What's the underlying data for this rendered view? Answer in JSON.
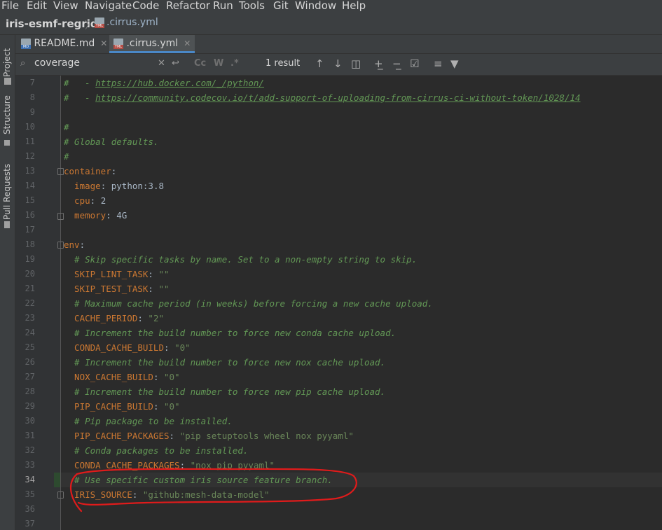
{
  "menu": [
    "File",
    "Edit",
    "View",
    "Navigate",
    "Code",
    "Refactor",
    "Run",
    "Tools",
    "Git",
    "Window",
    "Help"
  ],
  "breadcrumb": {
    "project": "iris-esmf-regrid",
    "file": ".cirrus.yml"
  },
  "side_tabs": {
    "project": "Project",
    "structure": "Structure",
    "pull_requests": "Pull Requests"
  },
  "tabs": [
    {
      "label": "README.md",
      "active": false
    },
    {
      "label": ".cirrus.yml",
      "active": true
    }
  ],
  "search": {
    "query": "coverage",
    "match_case": "Cc",
    "words": "W",
    "regex": ".*",
    "result": "1 result"
  },
  "lines": [
    {
      "n": "7",
      "parts": [
        [
          "c-com",
          "#   - "
        ],
        [
          "c-link",
          "https://hub.docker.com/_/python/"
        ]
      ]
    },
    {
      "n": "8",
      "parts": [
        [
          "c-com",
          "#   - "
        ],
        [
          "c-link",
          "https://community.codecov.io/t/add-support-of-uploading-from-cirrus-ci-without-token/1028/14"
        ]
      ]
    },
    {
      "n": "9",
      "parts": []
    },
    {
      "n": "10",
      "parts": [
        [
          "c-com",
          "#"
        ]
      ]
    },
    {
      "n": "11",
      "parts": [
        [
          "c-com",
          "# Global defaults."
        ]
      ]
    },
    {
      "n": "12",
      "parts": [
        [
          "c-com",
          "#"
        ]
      ]
    },
    {
      "n": "13",
      "parts": [
        [
          "c-key",
          "container"
        ],
        [
          "c-plain",
          ":"
        ]
      ]
    },
    {
      "n": "14",
      "parts": [
        [
          "c-key",
          "  image"
        ],
        [
          "c-plain",
          ": python:3.8"
        ]
      ]
    },
    {
      "n": "15",
      "parts": [
        [
          "c-key",
          "  cpu"
        ],
        [
          "c-plain",
          ": 2"
        ]
      ]
    },
    {
      "n": "16",
      "parts": [
        [
          "c-key",
          "  memory"
        ],
        [
          "c-plain",
          ": 4G"
        ]
      ]
    },
    {
      "n": "17",
      "parts": []
    },
    {
      "n": "18",
      "parts": [
        [
          "c-key",
          "env"
        ],
        [
          "c-plain",
          ":"
        ]
      ]
    },
    {
      "n": "19",
      "parts": [
        [
          "c-com",
          "  # Skip specific tasks by name. Set to a non-empty string to skip."
        ]
      ]
    },
    {
      "n": "20",
      "parts": [
        [
          "c-key",
          "  SKIP_LINT_TASK"
        ],
        [
          "c-plain",
          ": "
        ],
        [
          "c-str",
          "\"\""
        ]
      ]
    },
    {
      "n": "21",
      "parts": [
        [
          "c-key",
          "  SKIP_TEST_TASK"
        ],
        [
          "c-plain",
          ": "
        ],
        [
          "c-str",
          "\"\""
        ]
      ]
    },
    {
      "n": "22",
      "parts": [
        [
          "c-com",
          "  # Maximum cache period (in weeks) before forcing a new cache upload."
        ]
      ]
    },
    {
      "n": "23",
      "parts": [
        [
          "c-key",
          "  CACHE_PERIOD"
        ],
        [
          "c-plain",
          ": "
        ],
        [
          "c-str",
          "\"2\""
        ]
      ]
    },
    {
      "n": "24",
      "parts": [
        [
          "c-com",
          "  # Increment the build number to force new conda cache upload."
        ]
      ]
    },
    {
      "n": "25",
      "parts": [
        [
          "c-key",
          "  CONDA_CACHE_BUILD"
        ],
        [
          "c-plain",
          ": "
        ],
        [
          "c-str",
          "\"0\""
        ]
      ]
    },
    {
      "n": "26",
      "parts": [
        [
          "c-com",
          "  # Increment the build number to force new nox cache upload."
        ]
      ]
    },
    {
      "n": "27",
      "parts": [
        [
          "c-key",
          "  NOX_CACHE_BUILD"
        ],
        [
          "c-plain",
          ": "
        ],
        [
          "c-str",
          "\"0\""
        ]
      ]
    },
    {
      "n": "28",
      "parts": [
        [
          "c-com",
          "  # Increment the build number to force new pip cache upload."
        ]
      ]
    },
    {
      "n": "29",
      "parts": [
        [
          "c-key",
          "  PIP_CACHE_BUILD"
        ],
        [
          "c-plain",
          ": "
        ],
        [
          "c-str",
          "\"0\""
        ]
      ]
    },
    {
      "n": "30",
      "parts": [
        [
          "c-com",
          "  # Pip package to be installed."
        ]
      ]
    },
    {
      "n": "31",
      "parts": [
        [
          "c-key",
          "  PIP_CACHE_PACKAGES"
        ],
        [
          "c-plain",
          ": "
        ],
        [
          "c-str",
          "\"pip setuptools wheel nox pyyaml\""
        ]
      ]
    },
    {
      "n": "32",
      "parts": [
        [
          "c-com",
          "  # Conda packages to be installed."
        ]
      ]
    },
    {
      "n": "33",
      "parts": [
        [
          "c-key",
          "  CONDA_CACHE_PACKAGES"
        ],
        [
          "c-plain",
          ": "
        ],
        [
          "c-str",
          "\"nox pip pyyaml\""
        ]
      ]
    },
    {
      "n": "34",
      "parts": [
        [
          "c-com",
          "  # Use specific custom iris source feature branch."
        ]
      ]
    },
    {
      "n": "35",
      "parts": [
        [
          "c-key",
          "  IRIS_SOURCE"
        ],
        [
          "c-plain",
          ": "
        ],
        [
          "c-str",
          "\"github:mesh-data-model\""
        ]
      ]
    },
    {
      "n": "36",
      "parts": []
    },
    {
      "n": "37",
      "parts": []
    }
  ],
  "current_line": "34",
  "colors": {
    "accent": "#4a88c7",
    "annotation": "#e01b1b"
  }
}
